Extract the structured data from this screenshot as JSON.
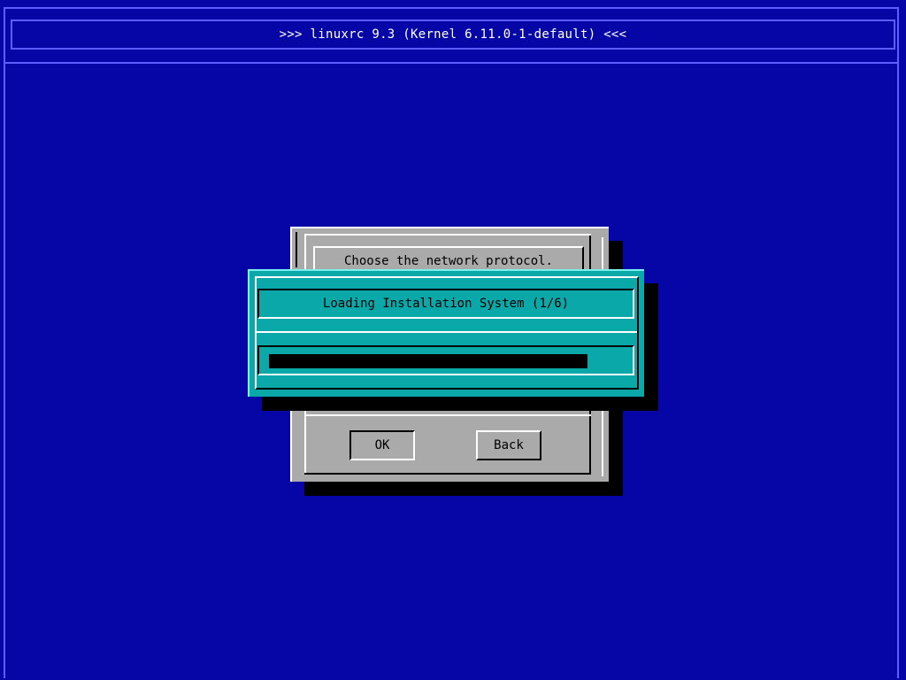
{
  "header": {
    "title": ">>> linuxrc 9.3 (Kernel 6.11.0-1-default)  <<<"
  },
  "network_dialog": {
    "prompt": "Choose the network protocol.",
    "ok_label": "OK",
    "back_label": "Back"
  },
  "progress_dialog": {
    "title": "Loading Installation System (1/6)",
    "progress_fraction": 0.9
  },
  "colors": {
    "background": "#0606a6",
    "frame": "#5c5cff",
    "dialog_gray": "#aaaaaa",
    "dialog_teal": "#0aa8a8",
    "progress_fill": "#000000"
  }
}
